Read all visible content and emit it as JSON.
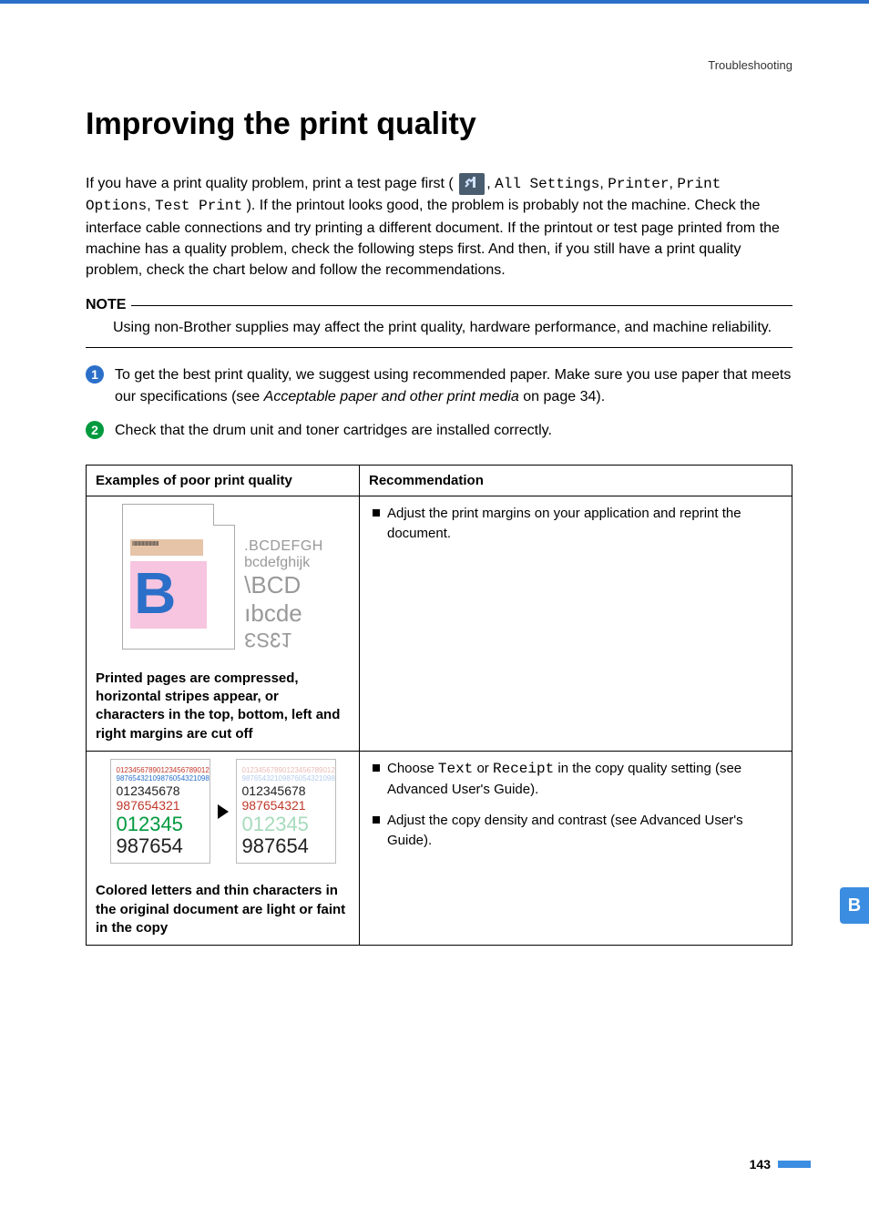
{
  "breadcrumb": "Troubleshooting",
  "title": "Improving the print quality",
  "intro_parts": {
    "p1a": "If you have a print quality problem, print a test page first (",
    "menu1": "All Settings",
    "menu2": "Printer",
    "menu3": "Print Options",
    "menu4": "Test Print",
    "p1b": "). If the printout looks good, the problem is probably not the machine. Check the interface cable connections and try printing a different document. If the printout or test page printed from the machine has a quality problem, check the following steps first. And then, if you still have a print quality problem, check the chart below and follow the recommendations."
  },
  "note": {
    "label": "NOTE",
    "text": "Using non-Brother supplies may affect the print quality, hardware performance, and machine reliability."
  },
  "steps": [
    {
      "n": "1",
      "prefix": "To get the best print quality, we suggest using recommended paper. Make sure you use paper that meets our specifications (see ",
      "link": "Acceptable paper and other print media",
      "suffix": " on page 34)."
    },
    {
      "n": "2",
      "prefix": "Check that the drum unit and toner cartridges are installed correctly.",
      "link": "",
      "suffix": ""
    }
  ],
  "table": {
    "h1": "Examples of poor print quality",
    "h2": "Recommendation",
    "rows": [
      {
        "caption": "Printed pages are compressed, horizontal stripes appear, or characters in the top, bottom, left and right margins are cut off",
        "recs": [
          {
            "pre": "Adjust the print margins on your application and reprint the document.",
            "mono1": "",
            "mid": "",
            "mono2": "",
            "post": ""
          }
        ],
        "ex1_lines": {
          "l1": ".BCDEFGH",
          "l2": "bcdefghijk",
          "l3": "\\BCD",
          "l4": "ıbcde",
          "l5": "ƐƧ↋1"
        },
        "ex1_b": "B"
      },
      {
        "caption": "Colored letters and thin characters in the original document are light or faint in the copy",
        "recs": [
          {
            "pre": "Choose ",
            "mono1": "Text",
            "mid": " or ",
            "mono2": "Receipt",
            "post": " in the copy quality setting (see Advanced User's Guide)."
          },
          {
            "pre": "Adjust the copy density and contrast (see Advanced User's Guide).",
            "mono1": "",
            "mid": "",
            "mono2": "",
            "post": ""
          }
        ],
        "ex2": {
          "tiny_r": "01234567890123456789012",
          "tiny_b": "98765432109876054321098",
          "med_k1": "012345678",
          "med_r1": "987654321",
          "big_g": "012345",
          "big_k": "987654"
        }
      }
    ]
  },
  "side_tab": "B",
  "page_number": "143"
}
